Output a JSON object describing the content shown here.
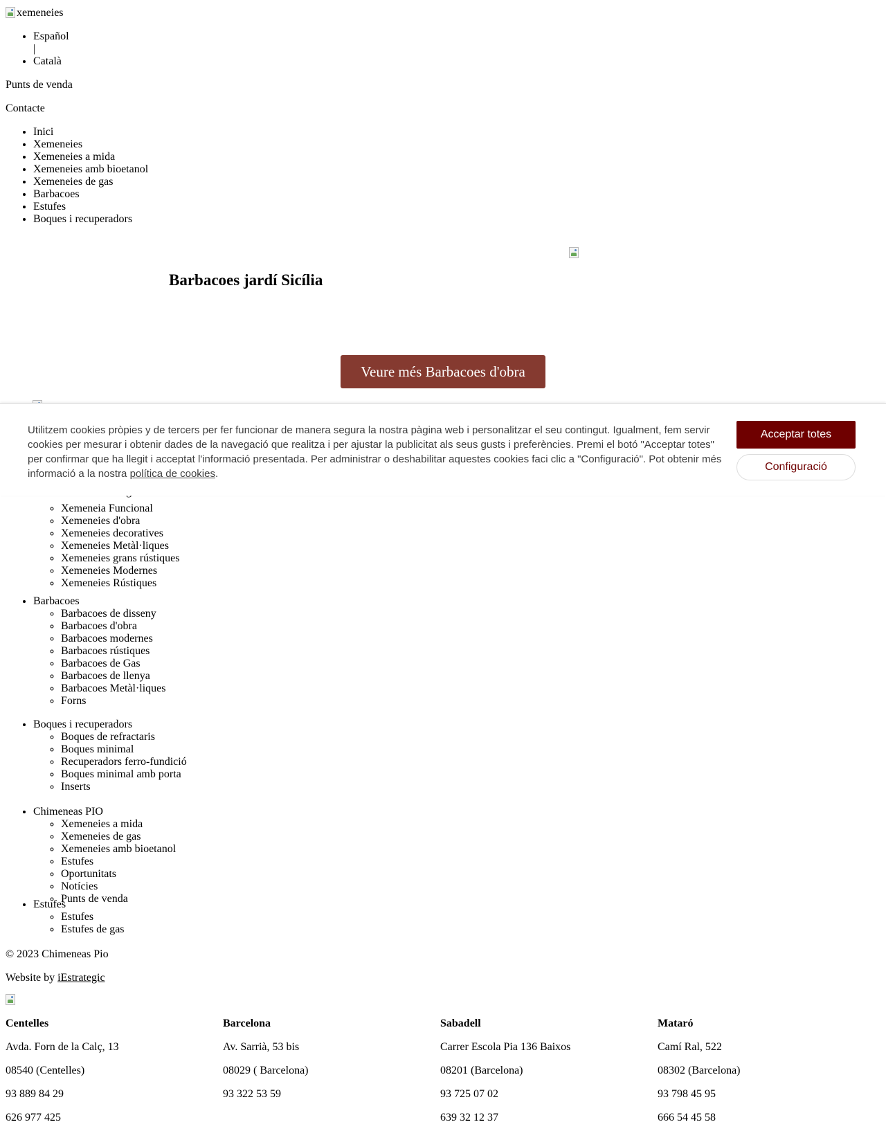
{
  "header": {
    "logo_alt": "xemeneies",
    "languages": [
      "Español",
      "Català"
    ],
    "lang_separator": "|",
    "links": {
      "sales_points": "Punts de venda",
      "contact": "Contacte"
    }
  },
  "nav": {
    "items": [
      "Inici",
      "Xemeneies",
      "Xemeneies a mida",
      "Xemeneies amb bioetanol",
      "Xemeneies de gas",
      "Barbacoes",
      "Estufes",
      "Boques i recuperadors"
    ]
  },
  "main": {
    "title": "Barbacoes jardí Sicília",
    "cta_label": "Veure més Barbacoes d'obra"
  },
  "cookie": {
    "text": "Utilitzem cookies pròpies y de tercers per fer funcionar de manera segura la nostra pàgina web i personalitzar el seu contingut. Igualment, fem servir cookies per mesurar i obtenir dades de la navegació que realitza i per ajustar la publicitat als seus gusts i preferències. Premi el botó \"Acceptar totes\" per confirmar que ha llegit i acceptat l'informació presentada. Per administrar o deshabilitar aquestes cookies faci clic a \"Configuració\". Pot obtenir més informació a la nostra ",
    "policy_link": "política de cookies",
    "period": ".",
    "accept_label": "Acceptar totes",
    "config_label": "Configuració"
  },
  "footer_nav": {
    "xemeneies_partial": "Xemeneies de gas",
    "xemeneies_sub": [
      "Xemeneia Funcional",
      "Xemeneies d'obra",
      "Xemeneies decoratives",
      "Xemeneies Metàl·liques",
      "Xemeneies grans rústiques",
      "Xemeneies Modernes",
      "Xemeneies Rústiques"
    ],
    "barbacoes": {
      "label": "Barbacoes",
      "sub": [
        "Barbacoes de disseny",
        "Barbacoes d'obra",
        "Barbacoes modernes",
        "Barbacoes rústiques",
        "Barbacoes de Gas",
        "Barbacoes de llenya",
        "Barbacoes Metàl·liques",
        "Forns"
      ]
    },
    "boques": {
      "label": "Boques i recuperadors",
      "sub": [
        "Boques de refractaris",
        "Boques minimal",
        "Recuperadors ferro-fundició",
        "Boques minimal amb porta",
        "Inserts"
      ]
    },
    "pio": {
      "label": "Chimeneas PIO",
      "sub": [
        "Xemeneies a mida",
        "Xemeneies de gas",
        "Xemeneies amb bioetanol",
        "Estufes",
        "Oportunitats",
        "Notícies",
        "Punts de venda"
      ]
    },
    "estufes": {
      "label": "Estufes",
      "sub": [
        "Estufes",
        "Estufes de gas"
      ]
    }
  },
  "footer": {
    "copyright": "© 2023 Chimeneas Pio",
    "website_by": "Website by ",
    "agency": "iEstrategic"
  },
  "stores": [
    {
      "city": "Centelles",
      "address": "Avda. Forn de la Calç, 13",
      "postal": "08540 (Centelles)",
      "phone1": "93 889 84 29",
      "phone2": "626 977 425"
    },
    {
      "city": "Barcelona",
      "address": "Av. Sarrià, 53 bis",
      "postal": "08029 ( Barcelona)",
      "phone1": "93 322 53 59",
      "phone2": ""
    },
    {
      "city": "Sabadell",
      "address": "Carrer Escola Pia 136 Baixos",
      "postal": "08201 (Barcelona)",
      "phone1": "93 725 07 02",
      "phone2": "639 32 12 37"
    },
    {
      "city": "Mataró",
      "address": "Camí Ral, 522",
      "postal": "08302 (Barcelona)",
      "phone1": "93 798 45 95",
      "phone2": "666 54 45 58"
    }
  ]
}
